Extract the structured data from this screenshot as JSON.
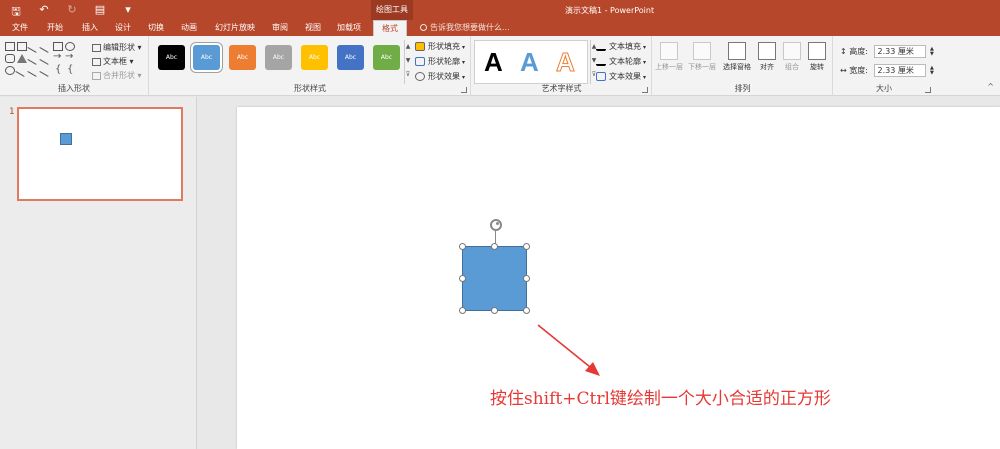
{
  "app": {
    "quick_access": [
      "save-icon",
      "undo-icon",
      "redo-icon",
      "present-icon",
      "customize-icon"
    ],
    "context_group": "绘图工具",
    "window_title": "演示文稿1 - PowerPoint"
  },
  "tabs": [
    {
      "label": "文件"
    },
    {
      "label": "开始"
    },
    {
      "label": "插入"
    },
    {
      "label": "设计"
    },
    {
      "label": "切换"
    },
    {
      "label": "动画"
    },
    {
      "label": "幻灯片放映"
    },
    {
      "label": "审阅"
    },
    {
      "label": "视图"
    },
    {
      "label": "加载项"
    },
    {
      "label": "格式",
      "active": true
    }
  ],
  "tell_me": "告诉我您想要做什么...",
  "ribbon": {
    "insert_shapes": {
      "label": "插入形状",
      "edit_shape": "编辑形状",
      "text_box": "文本框",
      "merge_shapes": "合并形状"
    },
    "shape_styles": {
      "label": "形状样式",
      "preset_text": "Abc",
      "preset_colors": [
        "#000000",
        "#5b9bd5",
        "#ed7d31",
        "#a5a5a5",
        "#ffc000",
        "#4472c4",
        "#70ad47"
      ],
      "selected_index": 1,
      "fill": "形状填充",
      "outline": "形状轮廓",
      "effects": "形状效果"
    },
    "wordart": {
      "label": "艺术字样式",
      "samples": [
        "A",
        "A",
        "A"
      ],
      "text_fill": "文本填充",
      "text_outline": "文本轮廓",
      "text_effects": "文本效果"
    },
    "arrange": {
      "label": "排列",
      "bring_forward": "上移一层",
      "send_backward": "下移一层",
      "selection_pane": "选择窗格",
      "align": "对齐",
      "group": "组合",
      "rotate": "旋转"
    },
    "size": {
      "label": "大小",
      "height_label": "高度:",
      "height_value": "2.33 厘米",
      "width_label": "宽度:",
      "width_value": "2.33 厘米"
    }
  },
  "slides_pane": {
    "slide_number": "1"
  },
  "annotation": {
    "text": "按住shift+Ctrl键绘制一个大小合适的正方形",
    "color": "#e53935"
  }
}
